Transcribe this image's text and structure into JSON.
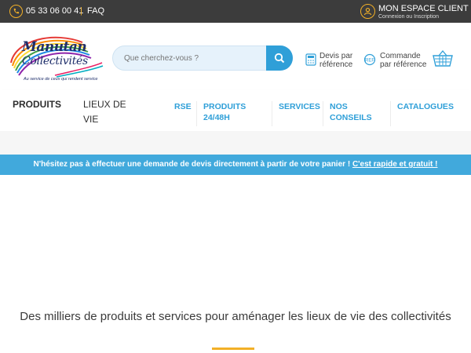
{
  "topbar": {
    "phone": "05 33 06 00 41",
    "separator": "|",
    "faq": "FAQ",
    "account_title": "MON ESPACE CLIENT",
    "account_sub": "Connexion ou Inscription"
  },
  "logo": {
    "line1": "Manutan",
    "line2": "Collectivités",
    "tagline": "Au service de ceux qui rendent service"
  },
  "search": {
    "placeholder": "Que cherchez-vous ?"
  },
  "quick_links": {
    "quote_line1": "Devis par",
    "quote_line2": "référence",
    "order_line1": "Commande",
    "order_line2": "par référence"
  },
  "nav": {
    "produits": "PRODUITS",
    "lieux_line1": "LIEUX DE",
    "lieux_line2": "VIE",
    "rse": "RSE",
    "produits48_line1": "PRODUITS",
    "produits48_line2": "24/48H",
    "services": "SERVICES",
    "conseils_line1": "NOS",
    "conseils_line2": "CONSEILS",
    "catalogues": "CATALOGUES"
  },
  "banner": {
    "text": "N'hésitez pas à effectuer une demande de devis directement à partir de votre panier ! ",
    "link": "C'est rapide et gratuit !"
  },
  "main": {
    "tagline": "Des milliers de produits et services pour aménager les lieux de vie des collectivités"
  },
  "colors": {
    "accent_blue": "#2f9fd8",
    "accent_yellow": "#f2b027",
    "topbar": "#3c3c3c"
  }
}
